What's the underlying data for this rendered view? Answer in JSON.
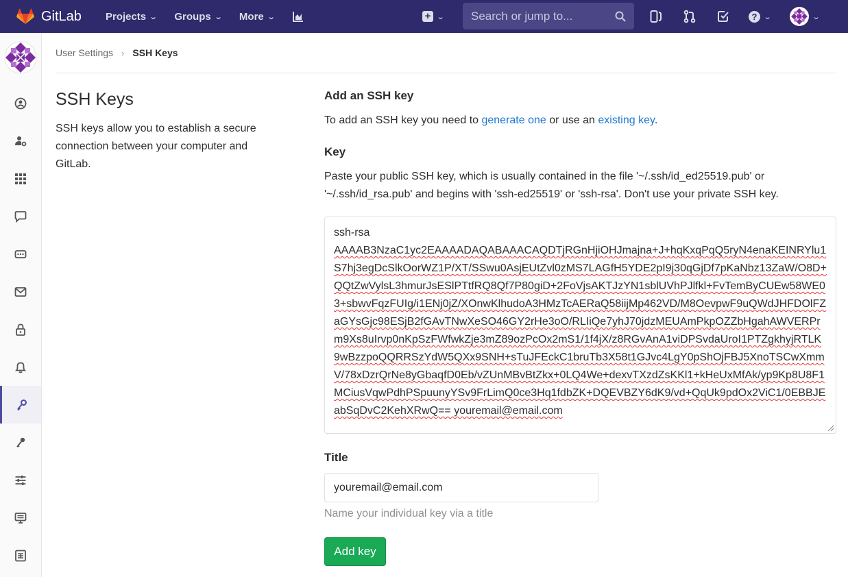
{
  "navbar": {
    "brand": "GitLab",
    "menu": [
      {
        "label": "Projects"
      },
      {
        "label": "Groups"
      },
      {
        "label": "More"
      }
    ],
    "search_placeholder": "Search or jump to..."
  },
  "breadcrumb": {
    "parent": "User Settings",
    "current": "SSH Keys"
  },
  "left": {
    "title": "SSH Keys",
    "description": "SSH keys allow you to establish a secure connection between your computer and GitLab."
  },
  "form": {
    "add_title": "Add an SSH key",
    "intro_prefix": "To add an SSH key you need to ",
    "intro_link1": "generate one",
    "intro_middle": " or use an ",
    "intro_link2": "existing key",
    "intro_suffix": ".",
    "key_label": "Key",
    "key_help": "Paste your public SSH key, which is usually contained in the file '~/.ssh/id_ed25519.pub' or '~/.ssh/id_rsa.pub' and begins with 'ssh-ed25519' or 'ssh-rsa'. Don't use your private SSH key.",
    "key_line1": "ssh-rsa",
    "key_value": "AAAAB3NzaC1yc2EAAAADAQABAAACAQDTjRGnHjiOHJmajna+J+hqKxqPqQ5ryN4enaKEINRYlu1S7hj3egDcSlkOorWZ1P/XT/SSwu0AsjEUtZvl0zMS7LAGfH5YDE2pI9j30qGjDf7pKaNbz13ZaW/O8D+QQtZwVylsL3hmurJsESlPTtfRQ8Qf7P80giD+2FoVjsAKTJzYN1sblUVhPJlfkl+FvTemByCUEw58WE03+sbwvFqzFUIg/i1ENj0jZ/XOnwKlhudoA3HMzTcAERaQ58iijMp462VD/M8OevpwF9uQWdJHFDOlFZaGYsGjc98ESjB2fGAvTNwXeSO46GY2rHe3oO/RLIiQe7yhJ70jdzMEUAmPkpOZZbHgahAWVERPrm9Xs8uIrvp0nKpSzFWfwkZje3mZ89ozPcOx2mS1/1f4jX/z8RGvAnA1viDPSvdaUroI1PTZgkhyjRTLK9wBzzpoQQRRSzYdW5QXx9SNH+sTuJFEckC1bruTb3X58t1GJvc4LgY0pShOjFBJ5XnoTSCwXmmV/78xDzrQrNe8yGbaqfD0Eb/vZUnMBvBtZkx+0LQ4We+dexvTXzdZsKKl1+kHeUxMfAk/yp9Kp8U8F1MCiusVqwPdhPSpuunyYSv9FrLimQ0ce3Hq1fdbZK+DQEVBZY6dK9/vd+QqUk9pdOx2ViC1/0EBBJEabSqDvC2KehXRwQ== youremail@email.com",
    "title_label": "Title",
    "title_value": "youremail@email.com",
    "title_help": "Name your individual key via a title",
    "submit_label": "Add key"
  },
  "colors": {
    "navbar_bg": "#2f2a6b",
    "link": "#1f78d1",
    "submit_bg": "#1aaa55"
  }
}
